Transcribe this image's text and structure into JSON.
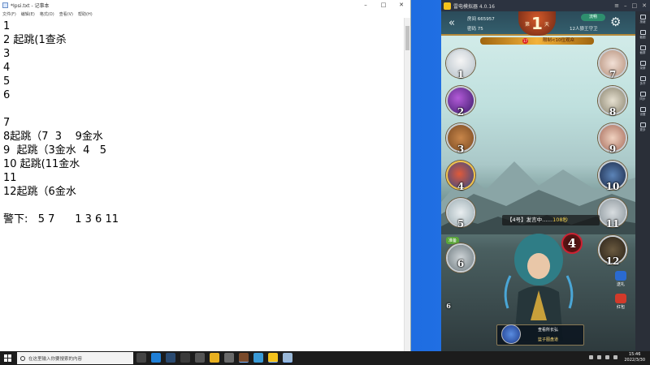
{
  "notepad": {
    "title": "*Ipsi.txt - 记事本",
    "menu": [
      "文件(F)",
      "编辑(E)",
      "格式(O)",
      "查看(V)",
      "帮助(H)"
    ],
    "lines": [
      "1",
      "2 起跳(1查杀",
      "3",
      "4",
      "5",
      "6",
      "",
      "7",
      "8起跳（7  3    9金水",
      "9  起跳（3金水  4   5",
      "10 起跳(11金水",
      "11",
      "12起跳（6金水",
      "",
      "警下:   5 7      1 3 6 11"
    ]
  },
  "emulator": {
    "title": "雷电模拟器 4.0.16",
    "sidebar": [
      "按键",
      "截图",
      "截屏",
      "录屏",
      "多开",
      "同步",
      "设置",
      "更多"
    ]
  },
  "game": {
    "room_label": "房间 665957",
    "password_label": "密码 75",
    "round_prefix": "第",
    "round_number": "1",
    "round_suffix": "天",
    "mode_label": "流畅",
    "rule_label": "12人狼王守卫",
    "banner_text": "限制<10位观众",
    "banner_flag": "17",
    "speaking_text": "【4号】发言中……",
    "speaking_secs": "108秒",
    "speaker_number": "4",
    "left_seats": [
      "1",
      "2",
      "3",
      "4",
      "5",
      "6"
    ],
    "right_seats": [
      "7",
      "8",
      "9",
      "10",
      "11",
      "12"
    ],
    "ready_tag": "准备",
    "bottom_row1": "查看所长弘",
    "bottom_row2": "篮子图盘道",
    "gift1": "送礼",
    "gift2": "红包",
    "small_count": "6"
  },
  "taskbar": {
    "search_placeholder": "在这里输入你要搜索的内容",
    "time": "15:46",
    "date": "2022/3/30"
  }
}
